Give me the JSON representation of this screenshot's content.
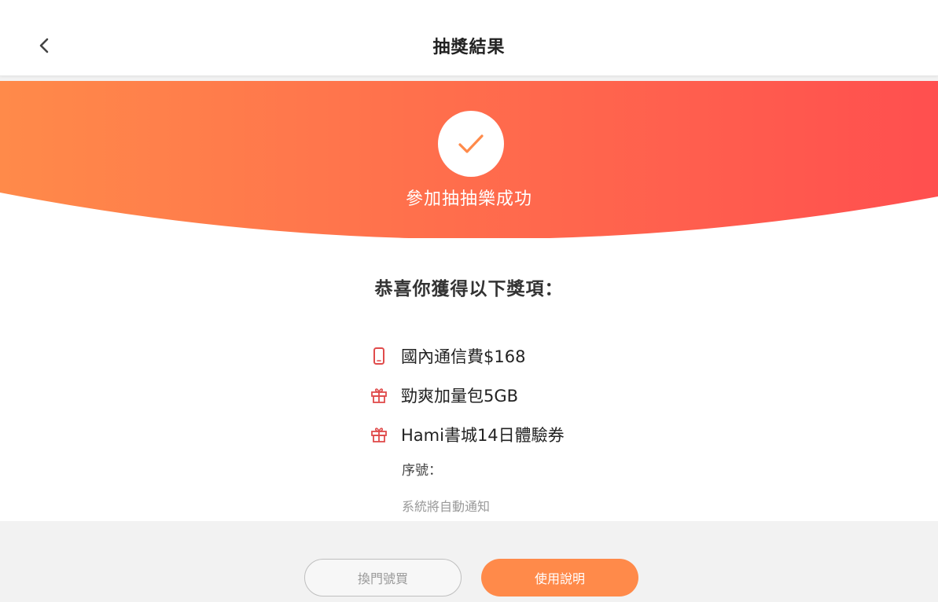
{
  "header": {
    "title": "抽獎結果",
    "back_icon": "chevron-left-icon"
  },
  "banner": {
    "message": "參加抽抽樂成功",
    "icon": "check-icon",
    "gradient_start": "#ff8a4a",
    "gradient_end": "#ff4f4f"
  },
  "prizes": {
    "heading": "恭喜你獲得以下獎項：",
    "items": [
      {
        "icon": "phone-icon",
        "label": "國內通信費$168"
      },
      {
        "icon": "gift-icon",
        "label": "勁爽加量包5GB"
      },
      {
        "icon": "gift-icon",
        "label": "Hami書城14日體驗券"
      }
    ],
    "serial_label": "序號：",
    "notify_text": "系統將自動通知"
  },
  "footer": {
    "secondary_button": "換門號買",
    "primary_button": "使用說明",
    "primary_color": "#ff8a4a"
  }
}
